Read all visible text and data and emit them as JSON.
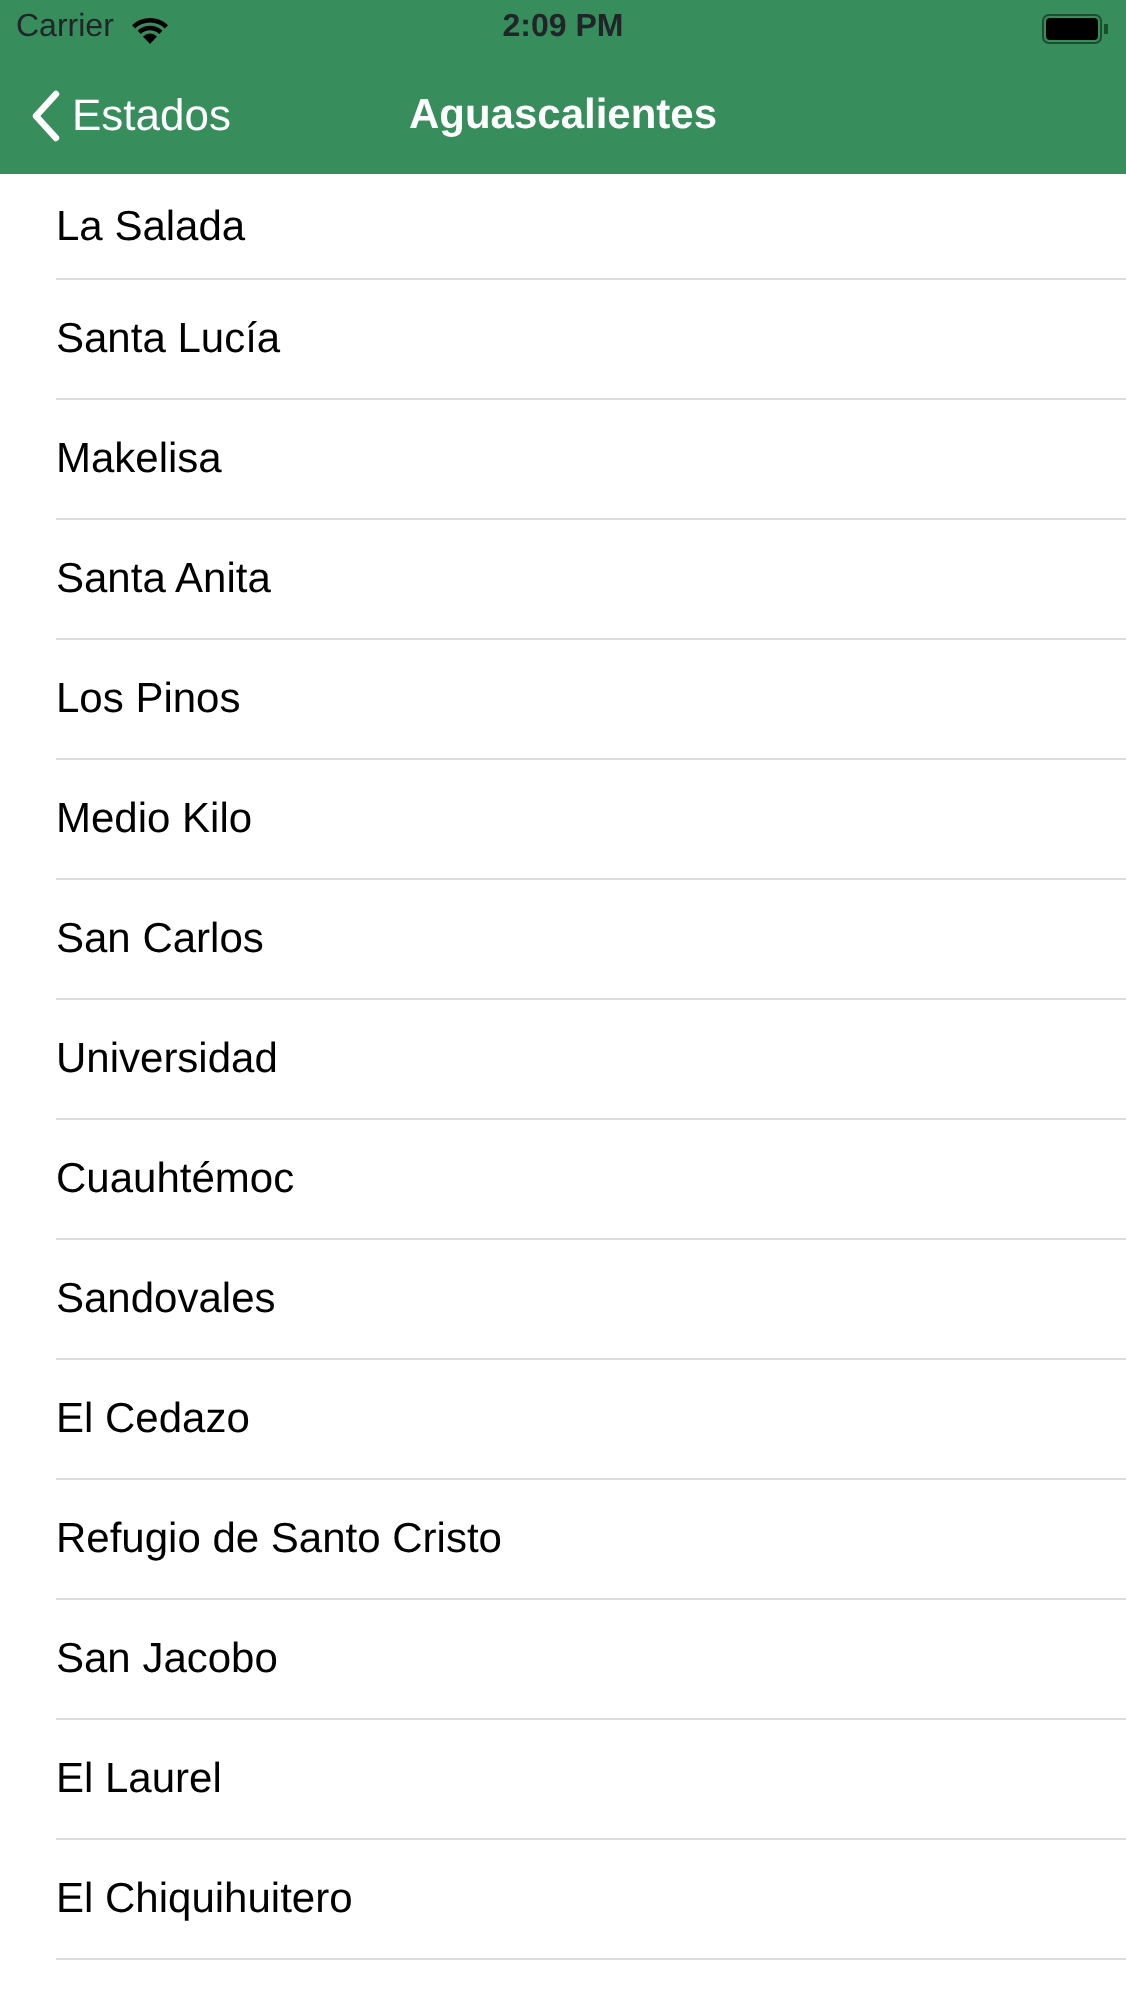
{
  "status_bar": {
    "carrier": "Carrier",
    "time": "2:09 PM"
  },
  "nav_bar": {
    "back_label": "Estados",
    "title": "Aguascalientes"
  },
  "items": [
    "La Salada",
    "Santa Lucía",
    "Makelisa",
    "Santa Anita",
    "Los Pinos",
    "Medio Kilo",
    "San Carlos",
    "Universidad",
    "Cuauhtémoc",
    "Sandovales",
    "El Cedazo",
    "Refugio de Santo Cristo",
    "San Jacobo",
    "El Laurel",
    "El Chiquihuitero"
  ]
}
